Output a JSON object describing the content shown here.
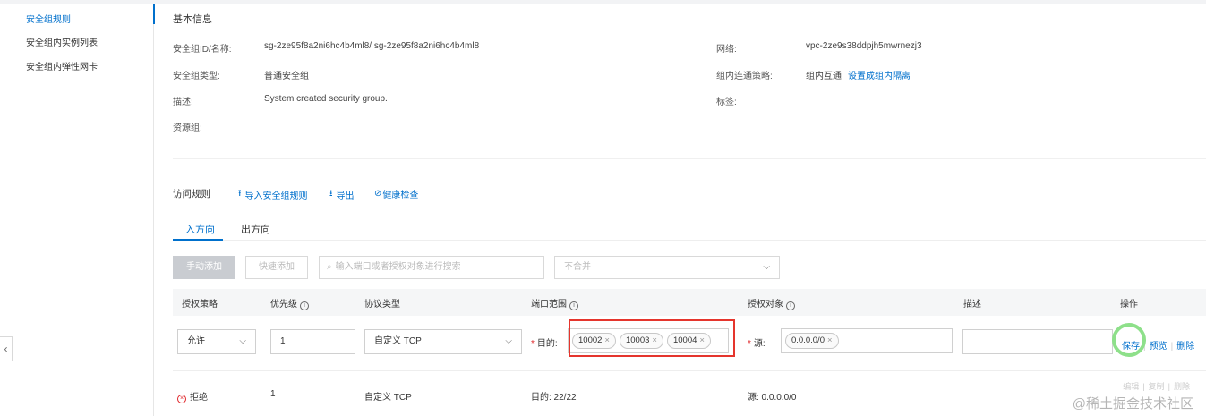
{
  "sidebar": {
    "items": [
      {
        "label": "安全组规则",
        "active": true
      },
      {
        "label": "安全组内实例列表",
        "active": false
      },
      {
        "label": "安全组内弹性网卡",
        "active": false
      }
    ],
    "collapse_glyph": "‹"
  },
  "basic": {
    "title": "基本信息",
    "id_label": "安全组ID/名称:",
    "id_value": "sg-2ze95f8a2ni6hc4b4ml8/ sg-2ze95f8a2ni6hc4b4ml8",
    "type_label": "安全组类型:",
    "type_value": "普通安全组",
    "desc_label": "描述:",
    "desc_value": "System created security group.",
    "rg_label": "资源组:",
    "network_label": "网络:",
    "network_value": "vpc-2ze9s38ddpjh5mwrnezj3",
    "policy_label": "组内连通策略:",
    "policy_value": "组内互通",
    "policy_link": "设置成组内隔离",
    "tags_label": "标签:"
  },
  "rules": {
    "title": "访问规则",
    "import_label": "导入安全组规则",
    "export_label": "导出",
    "health_label": "健康检查"
  },
  "tabs": {
    "inbound": "入方向",
    "outbound": "出方向"
  },
  "toolbar": {
    "manual_add": "手动添加",
    "quick_add": "快速添加",
    "search_placeholder": "输入端口或者授权对象进行搜索",
    "merge_select": "不合并"
  },
  "table": {
    "headers": {
      "policy": "授权策略",
      "priority": "优先级",
      "protocol": "协议类型",
      "port": "端口范围",
      "auth": "授权对象",
      "desc": "描述",
      "ops": "操作"
    }
  },
  "edit_row": {
    "policy": "允许",
    "priority": "1",
    "protocol": "自定义 TCP",
    "dest_label": "目的:",
    "ports": [
      "10002",
      "10003",
      "10004"
    ],
    "source_label": "源:",
    "sources": [
      "0.0.0.0/0"
    ],
    "desc": "",
    "save": "保存",
    "preview": "预览",
    "delete": "删除"
  },
  "data_row": {
    "policy": "拒绝",
    "priority": "1",
    "protocol": "自定义 TCP",
    "port": "目的: 22/22",
    "auth": "源: 0.0.0.0/0",
    "ops": [
      "编辑",
      "复制",
      "删除"
    ]
  },
  "watermark": "@稀土掘金技术社区",
  "colors": {
    "accent": "#0070cc",
    "highlight": "#e5352d",
    "deny": "#e0262a",
    "cursor_ring": "#8ee08a"
  }
}
